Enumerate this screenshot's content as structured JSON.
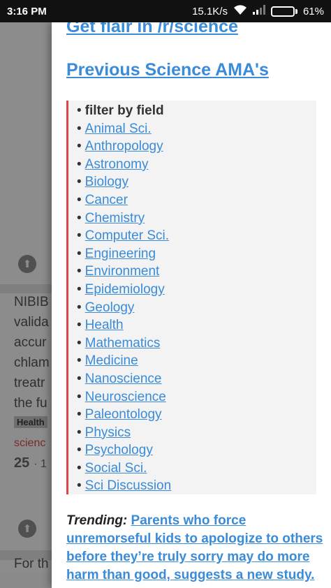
{
  "status_bar": {
    "time": "3:16 PM",
    "network_speed": "15.1K/s",
    "battery_percent": "61%",
    "battery_level": 0.61
  },
  "background_feed": {
    "post_title_fragments": "NIBIB\nvalida\naccur\nchlam\ntreatr\nthe fu",
    "flair": "Health",
    "subreddit": "scienc",
    "score": "25",
    "score_suffix": "· 1",
    "next_post_fragment": "For th"
  },
  "drawer": {
    "flair_link": "Get flair in /r/science",
    "ama_link": "Previous Science AMA's",
    "filter_heading": "filter by field",
    "fields": [
      "Animal Sci.",
      "Anthropology",
      "Astronomy",
      "Biology",
      "Cancer",
      "Chemistry",
      "Computer Sci.",
      "Engineering",
      "Environment",
      "Epidemiology",
      "Geology",
      "Health",
      "Mathematics",
      "Medicine",
      "Nanoscience",
      "Neuroscience",
      "Paleontology",
      "Physics",
      "Psychology",
      "Social Sci.",
      "Sci Discussion"
    ],
    "trending_label": "Trending:",
    "trending_link": "Parents who force unremorseful kids to apologize to others before they’re truly sorry may do more harm than good, suggests a new study."
  },
  "colors": {
    "link": "#3a8bd8",
    "accent_border": "#e04545",
    "status_bar": "#111111"
  }
}
